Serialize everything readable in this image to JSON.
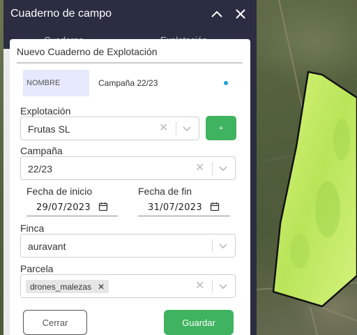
{
  "panel": {
    "title": "Cuaderno de campo",
    "tabs": [
      "Cuaderno",
      "Explotación"
    ]
  },
  "modal": {
    "title": "Nuevo Cuaderno de Explotación",
    "name_label": "NOMBRE",
    "name_value": "Campaña 22/23",
    "explotacion": {
      "label": "Explotación",
      "value": "Frutas SL",
      "add_label": "+"
    },
    "campana": {
      "label": "Campaña",
      "value": "22/23"
    },
    "fecha_inicio": {
      "label": "Fecha de inicio",
      "value": "29/07/2023"
    },
    "fecha_fin": {
      "label": "Fecha de fin",
      "value": "31/07/2023"
    },
    "finca": {
      "label": "Finca",
      "value": "auravant"
    },
    "parcela": {
      "label": "Parcela",
      "chips": [
        "drones_malezas"
      ]
    },
    "cancel_label": "Cerrar",
    "save_label": "Guardar"
  },
  "colors": {
    "panel_bg": "#2b2d42",
    "accent_green": "#3fb35f",
    "name_label_bg": "#e6e9fb",
    "dot_blue": "#22a0d8",
    "field_green": "#c6ec63"
  }
}
